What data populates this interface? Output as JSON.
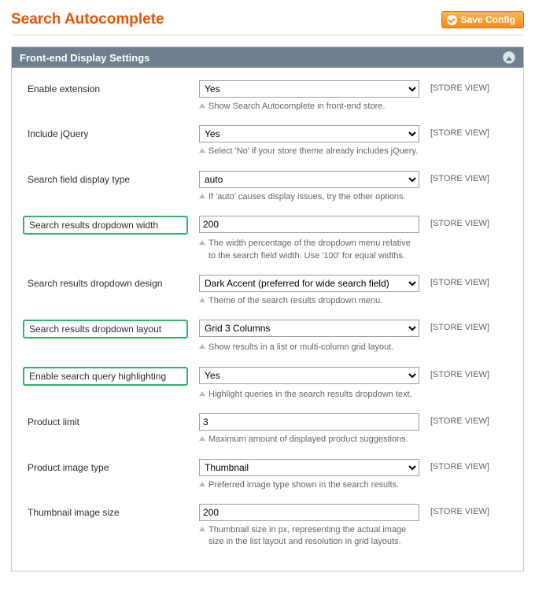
{
  "page_title": "Search Autocomplete",
  "save_button_label": "Save Config",
  "section_title": "Front-end Display Settings",
  "scope_label": "[STORE VIEW]",
  "rows": {
    "enable_extension": {
      "label": "Enable extension",
      "value": "Yes",
      "help": "Show Search Autocomplete in front-end store.",
      "highlighted": false,
      "type": "select"
    },
    "include_jquery": {
      "label": "Include jQuery",
      "value": "Yes",
      "help": "Select 'No' if your store theme already includes jQuery.",
      "highlighted": false,
      "type": "select"
    },
    "search_field_display_type": {
      "label": "Search field display type",
      "value": "auto",
      "help": "If 'auto' causes display issues, try the other options.",
      "highlighted": false,
      "type": "select"
    },
    "dropdown_width": {
      "label": "Search results dropdown width",
      "value": "200",
      "help": "The width percentage of the dropdown menu relative to the search field width. Use '100' for equal widths.",
      "highlighted": true,
      "type": "text"
    },
    "dropdown_design": {
      "label": "Search results dropdown design",
      "value": "Dark Accent (preferred for wide search field)",
      "help": "Theme of the search results dropdown menu.",
      "highlighted": false,
      "type": "select"
    },
    "dropdown_layout": {
      "label": "Search results dropdown layout",
      "value": "Grid 3 Columns",
      "help": "Show results in a list or multi-column grid layout.",
      "highlighted": true,
      "type": "select"
    },
    "query_highlight": {
      "label": "Enable search query highlighting",
      "value": "Yes",
      "help": "Highlight queries in the search results dropdown text.",
      "highlighted": true,
      "type": "select"
    },
    "product_limit": {
      "label": "Product limit",
      "value": "3",
      "help": "Maximum amount of displayed product suggestions.",
      "highlighted": false,
      "type": "text"
    },
    "product_image_type": {
      "label": "Product image type",
      "value": "Thumbnail",
      "help": "Preferred image type shown in the search results.",
      "highlighted": false,
      "type": "select"
    },
    "thumbnail_size": {
      "label": "Thumbnail image size",
      "value": "200",
      "help": "Thumbnail size in px, representing the actual image size in the list layout and resolution in grid layouts.",
      "highlighted": false,
      "type": "text"
    }
  },
  "row_order": [
    "enable_extension",
    "include_jquery",
    "search_field_display_type",
    "dropdown_width",
    "dropdown_design",
    "dropdown_layout",
    "query_highlight",
    "product_limit",
    "product_image_type",
    "thumbnail_size"
  ]
}
